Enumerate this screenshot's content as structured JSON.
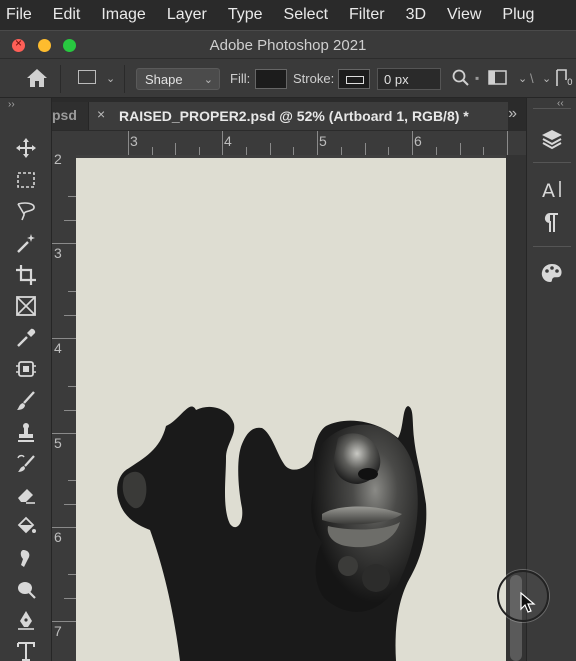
{
  "menubar": {
    "items": [
      "File",
      "Edit",
      "Image",
      "Layer",
      "Type",
      "Select",
      "Filter",
      "3D",
      "View",
      "Plug"
    ]
  },
  "window": {
    "title": "Adobe Photoshop 2021"
  },
  "options_bar": {
    "shape_mode": "Shape",
    "fill_label": "Fill:",
    "stroke_label": "Stroke:",
    "stroke_width": "0 px",
    "fill_color": "#1c1c1c",
    "stroke_color": "#1c1c1c"
  },
  "tabs": {
    "previous_tab": "psd",
    "active_tab": "RAISED_PROPER2.psd @ 52% (Artboard 1, RGB/8) *",
    "close_glyph": "×",
    "more_glyph": "»"
  },
  "rulers": {
    "top_labels": [
      "3",
      "4",
      "5",
      "6"
    ],
    "left_labels": [
      "2",
      "3",
      "4",
      "5",
      "6",
      "7"
    ]
  },
  "toolbar": {
    "collapse_glyph": "››",
    "tools": [
      "move-tool",
      "marquee-tool",
      "lasso-tool",
      "magic-wand-tool",
      "crop-tool",
      "frame-tool",
      "eyedropper-tool",
      "spot-healing-tool",
      "brush-tool",
      "clone-stamp-tool",
      "history-brush-tool",
      "eraser-tool",
      "paint-bucket-tool",
      "smudge-tool",
      "dodge-tool",
      "pen-tool",
      "type-tool"
    ]
  },
  "dock": {
    "collapse_glyph": "‹‹",
    "panels": [
      "layers-panel",
      "character-panel",
      "paragraph-panel",
      "swatches-panel"
    ]
  },
  "colors": {
    "artboard": "#deddd2",
    "silhouette": "#1a1a1a",
    "ui_dark": "#2b2b2b",
    "ui_panel": "#3a3a3a"
  }
}
